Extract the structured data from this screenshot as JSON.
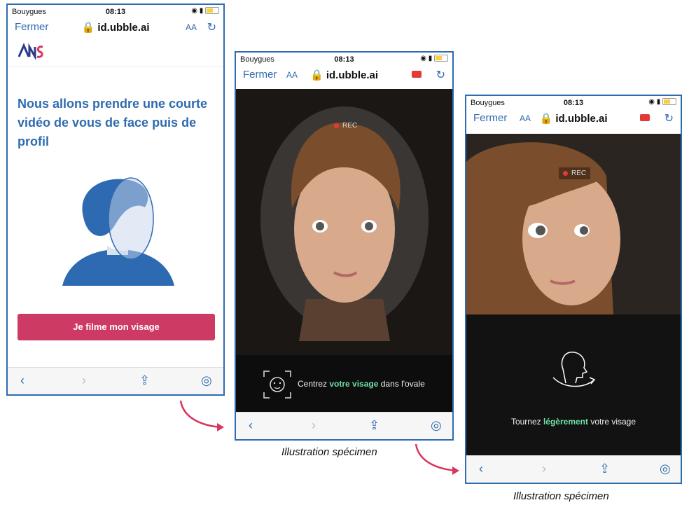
{
  "status": {
    "carrier": "Bouygues",
    "time": "08:13"
  },
  "browser": {
    "close": "Fermer",
    "domain": "id.ubble.ai",
    "text_size": "AA"
  },
  "screen1": {
    "title": "Nous allons prendre une courte vidéo de vous de face puis de profil",
    "button": "Je filme mon visage"
  },
  "screen2": {
    "rec": "REC",
    "hint_before": "Centrez ",
    "hint_bold": "votre visage",
    "hint_after": " dans l'ovale",
    "caption": "Illustration spécimen"
  },
  "screen3": {
    "rec": "REC",
    "hint_before": "Tournez ",
    "hint_bold": "légèrement",
    "hint_after": " votre visage",
    "caption": "Illustration spécimen"
  },
  "colors": {
    "accent": "#2f6bb0",
    "cta": "#cd3a63",
    "highlight": "#6ee0a6"
  }
}
